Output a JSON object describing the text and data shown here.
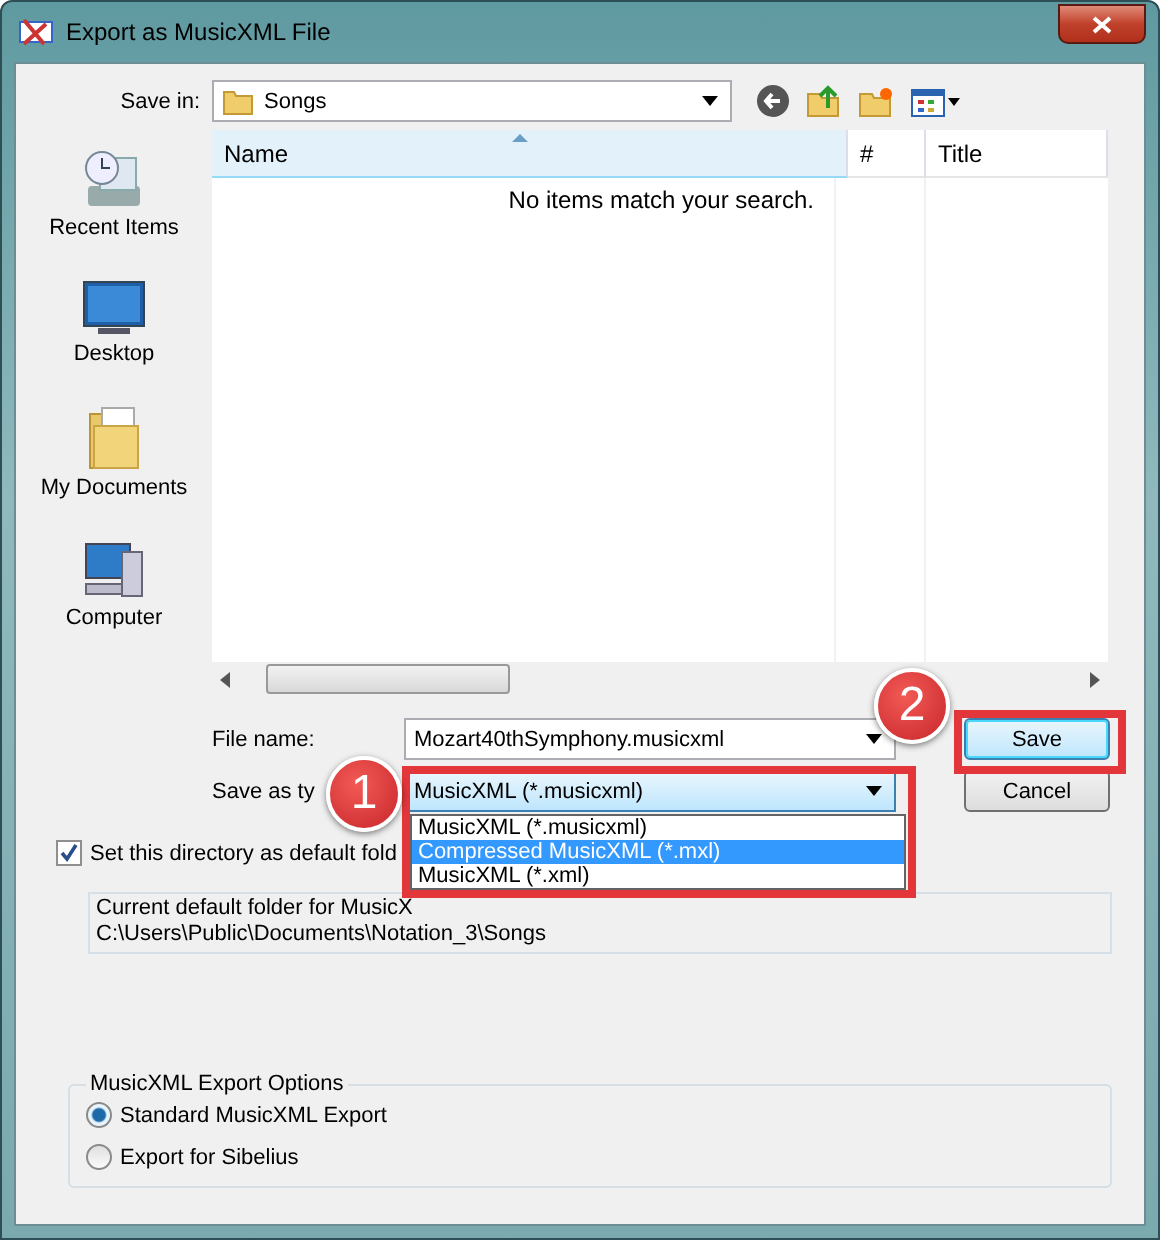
{
  "window": {
    "title": "Export as MusicXML File"
  },
  "save_in": {
    "label": "Save in:",
    "value": "Songs"
  },
  "places": [
    {
      "label": "Recent Items",
      "kind": "recent"
    },
    {
      "label": "Desktop",
      "kind": "desktop"
    },
    {
      "label": "My Documents",
      "kind": "documents"
    },
    {
      "label": "Computer",
      "kind": "computer"
    }
  ],
  "file_list": {
    "columns": [
      {
        "label": "Name",
        "sorted": true
      },
      {
        "label": "#",
        "sorted": false
      },
      {
        "label": "Title",
        "sorted": false
      }
    ],
    "empty_message": "No items match your search."
  },
  "file_name": {
    "label": "File name:",
    "value": "Mozart40thSymphony.musicxml"
  },
  "save_as_type": {
    "label": "Save as ty",
    "value": "MusicXML (*.musicxml)",
    "expanded": true,
    "options": [
      {
        "label": "MusicXML (*.musicxml)",
        "highlighted": false
      },
      {
        "label": "Compressed MusicXML (*.mxl)",
        "highlighted": true
      },
      {
        "label": "MusicXML (*.xml)",
        "highlighted": false
      }
    ]
  },
  "buttons": [
    {
      "label": "Save",
      "kind": "default"
    },
    {
      "label": "Cancel",
      "kind": "normal"
    }
  ],
  "default_folder": {
    "label": "Set this directory as default fold",
    "checked": true,
    "info": [
      "Current default folder for MusicX",
      "C:\\Users\\Public\\Documents\\Notation_3\\Songs"
    ]
  },
  "export_options": {
    "title": "MusicXML Export Options",
    "options": [
      {
        "label": "Standard MusicXML Export",
        "selected": true
      },
      {
        "label": "Export for Sibelius",
        "selected": false
      }
    ]
  },
  "annotations": [
    {
      "label": "1"
    },
    {
      "label": "2"
    }
  ]
}
